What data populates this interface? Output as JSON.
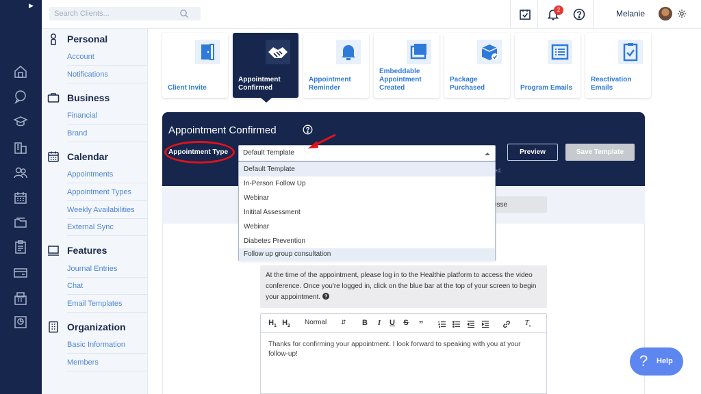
{
  "search": {
    "placeholder": "Search Clients..."
  },
  "topbar": {
    "notification_count": "2",
    "username": "Melanie"
  },
  "sidebar": {
    "sections": [
      {
        "title": "Personal",
        "items": [
          "Account",
          "Notifications"
        ]
      },
      {
        "title": "Business",
        "items": [
          "Financial",
          "Brand"
        ]
      },
      {
        "title": "Calendar",
        "items": [
          "Appointments",
          "Appointment Types",
          "Weekly Availabilities",
          "External Sync"
        ]
      },
      {
        "title": "Features",
        "items": [
          "Journal Entries",
          "Chat",
          "Email Templates"
        ]
      },
      {
        "title": "Organization",
        "items": [
          "Basic Information",
          "Members"
        ]
      }
    ]
  },
  "tiles": [
    {
      "label": "Client Invite",
      "icon": "door-icon"
    },
    {
      "label": "Appointment Confirmed",
      "icon": "handshake-icon"
    },
    {
      "label": "Appointment Reminder",
      "icon": "bell-icon"
    },
    {
      "label": "Embeddable Appointment Created",
      "icon": "window-icon"
    },
    {
      "label": "Package Purchased",
      "icon": "package-icon"
    },
    {
      "label": "Program Emails",
      "icon": "list-icon"
    },
    {
      "label": "Reactivation Emails",
      "icon": "clipboard-check-icon"
    }
  ],
  "editor": {
    "title": "Appointment Confirmed",
    "type_label": "Appointment Type",
    "selected_value": "Default Template",
    "preview_label": "Preview",
    "save_label": "Save Template",
    "hint_tail": "ed.",
    "pill_text": "esse",
    "info_text": "At the time of the appointment, please log in to the Healthie platform to access the video conference. Once you're logged in, click on the blue bar at the top of your screen to begin your appointment.",
    "format_select": "Normal",
    "body_text": "Thanks for confirming your appointment. I look forward to speaking with you at your follow-up!"
  },
  "dropdown": {
    "options": [
      "Default Template",
      "In-Person Follow Up",
      "Webinar",
      "Initital Assessment",
      "Webinar",
      "Diabetes Prevention",
      "Follow up group consultation"
    ]
  },
  "help": {
    "label": "Help"
  },
  "colors": {
    "navy": "#16264d",
    "accent": "#2f7ad9",
    "link": "#4e86d6",
    "annotation": "#e1121b",
    "help": "#5d86f1"
  }
}
